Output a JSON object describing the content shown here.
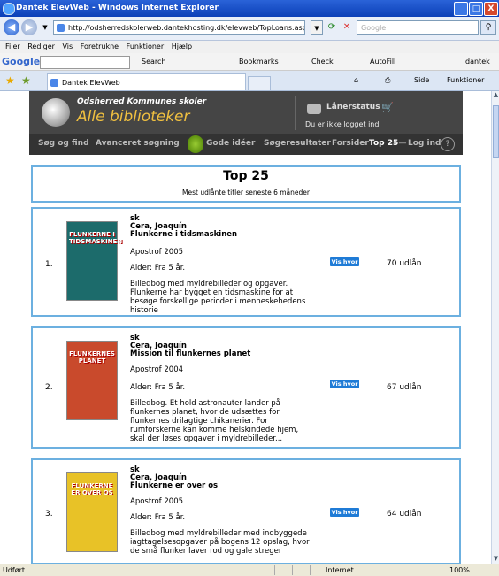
{
  "window": {
    "title": "Dantek ElevWeb - Windows Internet Explorer",
    "controls": [
      "_",
      "□",
      "X"
    ]
  },
  "address": {
    "url": "http://odsherredskolerweb.dantekhosting.dk/elevweb/TopLoans.aspx",
    "search_placeholder": "Google"
  },
  "menu": {
    "items": [
      "Filer",
      "Rediger",
      "Vis",
      "Foretrukne",
      "Funktioner",
      "Hjælp"
    ]
  },
  "google_toolbar": {
    "logo": "Google",
    "items": [
      "Search",
      "Bookmarks",
      "Check",
      "AutoFill",
      "dantek"
    ]
  },
  "tabs": {
    "active": "Dantek ElevWeb"
  },
  "commands": [
    "Side",
    "Funktioner"
  ],
  "site": {
    "subtitle": "Odsherred Kommunes skoler",
    "title": "Alle biblioteker",
    "status_label": "Lånerstatus",
    "login_note": "Du er ikke logget ind",
    "nav": [
      "Søg og find",
      "Avanceret søgning",
      "Gode idéer",
      "Søgeresultater",
      "Forsider",
      "Top 25"
    ],
    "login": "Log ind",
    "help": "?"
  },
  "top": {
    "heading": "Top 25",
    "subheading": "Mest udlånte titler seneste 6 måneder"
  },
  "items": [
    {
      "num": "1.",
      "cover_text": "FLUNKERNE I TIDSMASKINEN",
      "cover_color": "#1c6b6b",
      "type": "sk",
      "author": "Cera, Joaquín",
      "title": "Flunkerne i tidsmaskinen",
      "publisher": "Apostrof 2005",
      "age": "Alder: Fra 5 år.",
      "description": "Billedbog med myldrebilleder og opgaver. Flunkerne har bygget en tidsmaskine for at besøge forskellige perioder i menneskehedens historie",
      "button": "Vis hvor",
      "loans": "70 udlån"
    },
    {
      "num": "2.",
      "cover_text": "FLUNKERNES PLANET",
      "cover_color": "#c94a2c",
      "type": "sk",
      "author": "Cera, Joaquín",
      "title": "Mission til flunkernes planet",
      "publisher": "Apostrof 2004",
      "age": "Alder: Fra 5 år.",
      "description": "Billedbog. Et hold astronauter lander på flunkernes planet, hvor de udsættes for flunkernes drilagtige chikanerier. For rumforskerne kan komme helskindede hjem, skal der løses opgaver i myldrebilleder...",
      "button": "Vis hvor",
      "loans": "67 udlån"
    },
    {
      "num": "3.",
      "cover_text": "FLUNKERNE ER OVER OS",
      "cover_color": "#e8c227",
      "type": "sk",
      "author": "Cera, Joaquín",
      "title": "Flunkerne er over os",
      "publisher": "Apostrof 2005",
      "age": "Alder: Fra 5 år.",
      "description": "Billedbog med myldrebilleder med indbyggede iagttagelsesopgaver på bogens 12 opslag, hvor de små flunker laver rod og gale streger",
      "button": "Vis hvor",
      "loans": "64 udlån"
    }
  ],
  "statusbar": {
    "left": "Udført",
    "zone": "Internet",
    "zoom": "100%"
  }
}
